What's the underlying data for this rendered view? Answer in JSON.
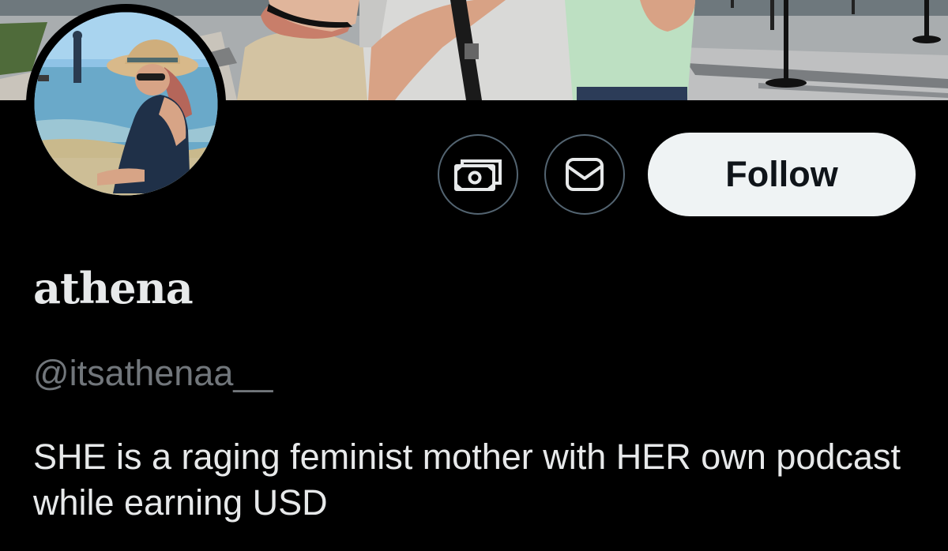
{
  "profile": {
    "display_name": "athena",
    "handle": "@itsathenaa__",
    "bio": "SHE is a raging feminist mother with HER own podcast while earning USD"
  },
  "actions": {
    "subscribe_icon": "money-icon",
    "message_icon": "envelope-icon",
    "follow_label": "Follow"
  },
  "colors": {
    "background": "#000000",
    "primary_text": "#e7e9ea",
    "secondary_text": "#71767b",
    "button_border": "#536471",
    "follow_bg": "#eff3f4",
    "follow_text": "#0f1419"
  }
}
